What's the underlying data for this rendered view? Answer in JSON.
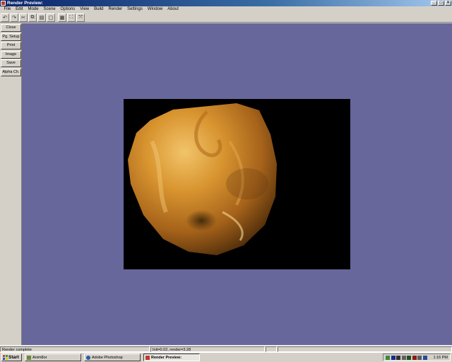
{
  "window": {
    "title": "Render Preview:",
    "buttons": [
      "_",
      "□",
      "×"
    ]
  },
  "menubar": {
    "items": [
      "File",
      "Edit",
      "Mode",
      "Scene",
      "Options",
      "View",
      "Build",
      "Render",
      "Settings",
      "Window",
      "About"
    ]
  },
  "toolbar": {
    "buttons": [
      {
        "name": "undo-icon",
        "glyph": "↶"
      },
      {
        "name": "redo-icon",
        "glyph": "↷"
      },
      {
        "name": "cut-icon",
        "glyph": "✂"
      },
      {
        "name": "copy-icon",
        "glyph": "⧉"
      },
      {
        "name": "paste-icon",
        "glyph": "▤"
      },
      {
        "name": "delete-icon",
        "glyph": "▢"
      },
      {
        "name": "grid-icon",
        "glyph": "▦"
      },
      {
        "name": "fit-view-icon",
        "glyph": "⛶"
      },
      {
        "name": "zoom-icon",
        "glyph": "⤧"
      }
    ]
  },
  "sidebar": {
    "buttons": [
      "Close",
      "Pg. Setup",
      "Print",
      "Image",
      "Save",
      "Alpha Ch."
    ]
  },
  "status": {
    "message": "Render complete",
    "timing": "Init=0.02, render=3.28"
  },
  "taskbar": {
    "start": "Start",
    "tasks": [
      {
        "label": "Anim8or",
        "active": false,
        "icon_color": "#6a8a3a"
      },
      {
        "label": "Adobe Photoshop",
        "active": false,
        "icon_color": "#2a5aa0"
      },
      {
        "label": "Render Preview:",
        "active": true,
        "icon_color": "#c0392b"
      }
    ],
    "clock": "1:16 PM"
  },
  "colors": {
    "canvas": "#67679c",
    "titlebar": "#0a246a",
    "sphere": "#d18a2e"
  }
}
